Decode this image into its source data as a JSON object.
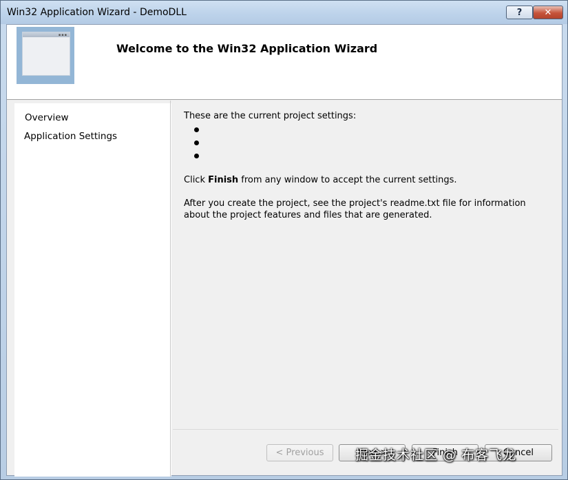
{
  "window": {
    "title": "Win32 Application Wizard - DemoDLL",
    "help_label": "?",
    "close_label": "✕"
  },
  "header": {
    "title": "Welcome to the Win32 Application Wizard",
    "image_icon": "window-graphic-icon"
  },
  "nav": {
    "items": [
      {
        "label": "Overview"
      },
      {
        "label": "Application Settings"
      }
    ]
  },
  "content": {
    "intro": "These are the current project settings:",
    "bullets": [
      "",
      "",
      ""
    ],
    "finish_prefix": "Click ",
    "finish_bold": "Finish",
    "finish_suffix": " from any window to accept the current settings.",
    "readme_line1": "After you create the project, see the project's readme.txt file for information",
    "readme_line2": "about the project features and files that are generated."
  },
  "buttons": {
    "previous": "< Previous",
    "next": "Next >",
    "finish": "Finish",
    "cancel": "Cancel"
  },
  "watermark": "掘金技术社区 @ 布客飞龙"
}
